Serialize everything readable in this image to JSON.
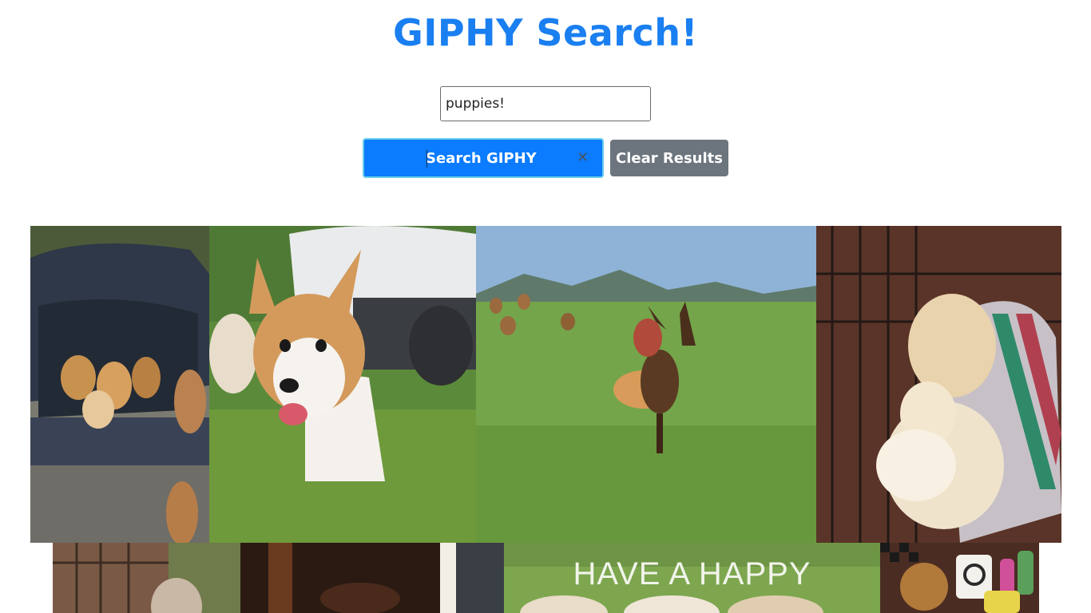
{
  "header": {
    "title": "GIPHY Search!"
  },
  "search": {
    "value": "puppies!",
    "button_label": "Search GIPHY",
    "clear_label": "Clear Results"
  },
  "results": {
    "row1": [
      {
        "icon": "beagle-puppies-in-car-trunk-gif"
      },
      {
        "icon": "corgi-puppy-running-gif"
      },
      {
        "icon": "dachshund-in-hotdog-bun-gif"
      },
      {
        "icon": "golden-puppies-hugging-gif"
      }
    ],
    "row2": [
      {
        "icon": "puppy-at-gate-gif"
      },
      {
        "icon": "dark-room-puppy-gif"
      },
      {
        "icon": "have-a-happy-puppies-gif",
        "caption": "HAVE A HAPPY"
      },
      {
        "icon": "cocker-spaniel-with-toys-gif"
      }
    ]
  },
  "colors": {
    "title": "#1a7ff0",
    "primary_button": "#0b7bff",
    "secondary_button": "#6c757d"
  }
}
